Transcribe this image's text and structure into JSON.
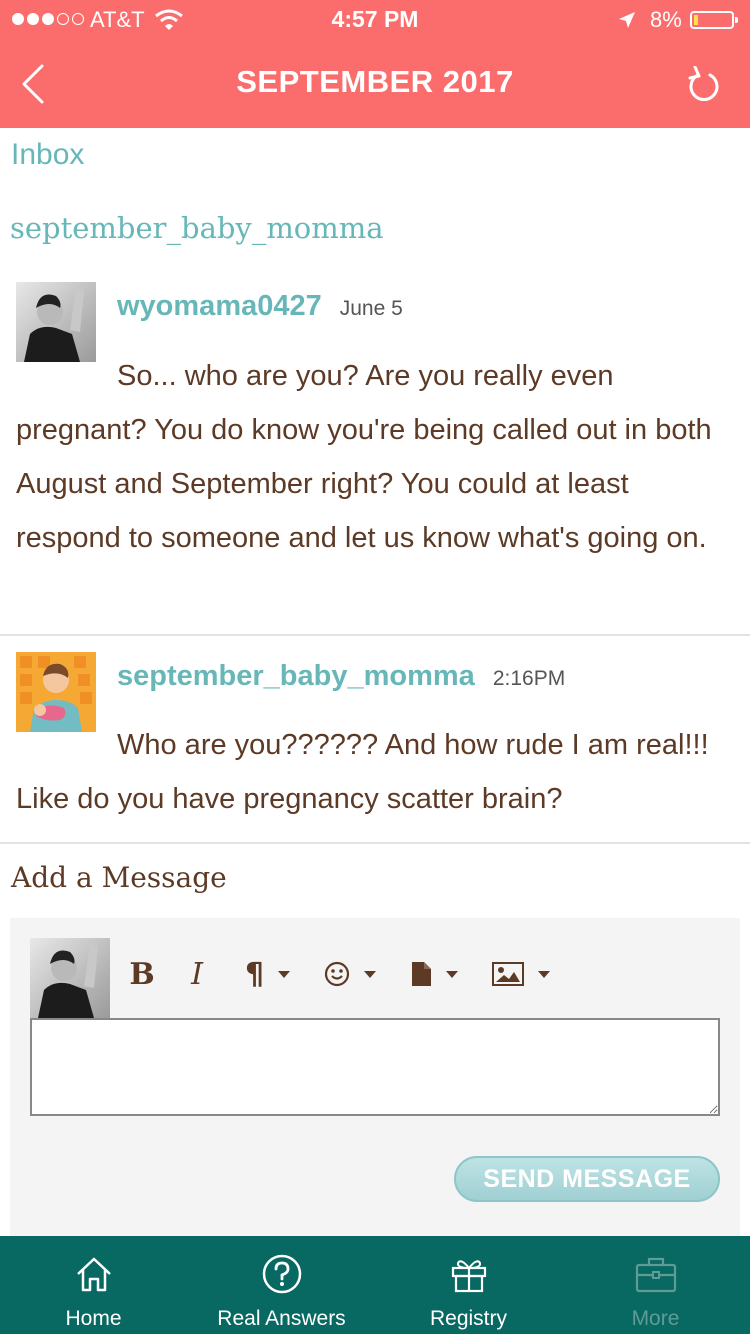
{
  "status_bar": {
    "carrier": "AT&T",
    "time": "4:57 PM",
    "battery": "8%"
  },
  "nav": {
    "title": "SEPTEMBER 2017"
  },
  "breadcrumb": {
    "inbox": "Inbox",
    "thread_user": "september_baby_momma"
  },
  "messages": [
    {
      "author": "wyomama0427",
      "date": "June 5",
      "body": "So... who are you? Are you really even pregnant? You do know you're being called out in both August and September right? You could at least respond to someone and let us know what's going on."
    },
    {
      "author": "september_baby_momma",
      "date": "2:16PM",
      "body": "Who are you?????? And how rude I am real!!! Like do you have pregnancy scatter brain?"
    }
  ],
  "composer": {
    "label": "Add a Message",
    "bold": "B",
    "italic": "I",
    "paragraph": "¶",
    "message_value": "",
    "send_label": "SEND MESSAGE"
  },
  "tabs": [
    {
      "label": "Home",
      "icon": "home-icon"
    },
    {
      "label": "Real Answers",
      "icon": "question-icon"
    },
    {
      "label": "Registry",
      "icon": "gift-icon"
    },
    {
      "label": "More",
      "icon": "briefcase-icon"
    }
  ],
  "colors": {
    "header": "#fb6d6c",
    "accent_teal": "#67b7b8",
    "body_brown": "#5d3a25",
    "tabbar": "#086862",
    "tab_inactive": "#5f9c98"
  }
}
